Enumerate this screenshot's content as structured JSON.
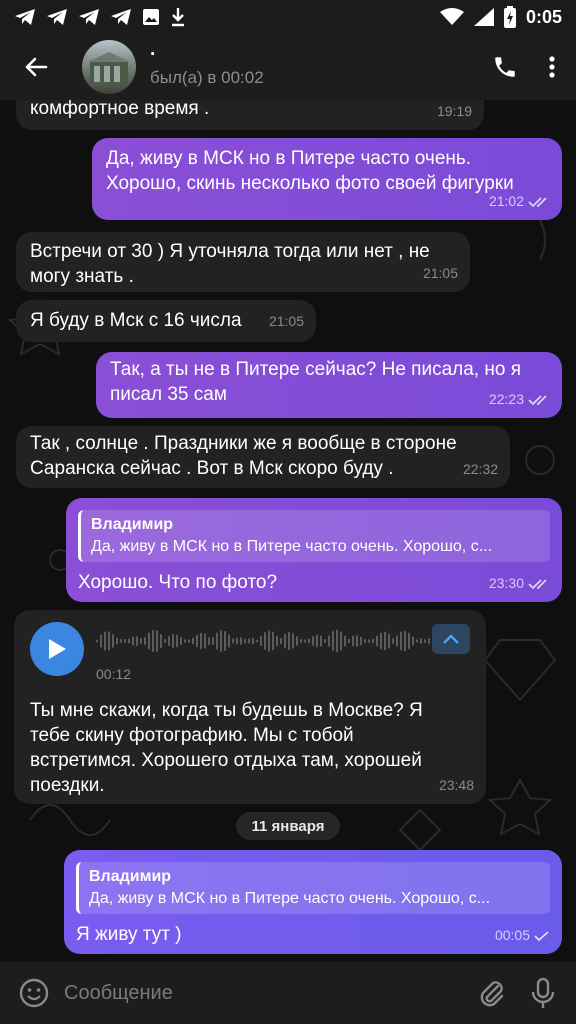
{
  "status_bar": {
    "time": "0:05"
  },
  "header": {
    "contact_name": "·",
    "last_seen": "был(а) в 00:02"
  },
  "messages": [
    {
      "id": 1,
      "direction": "in",
      "text": "комфортное время .",
      "time": "19:19"
    },
    {
      "id": 2,
      "direction": "out",
      "text": "Да, живу в МСК но в Питере часто очень. Хорошо, скинь несколько фото своей фигурки",
      "time": "21:02",
      "status": "read"
    },
    {
      "id": 3,
      "direction": "in",
      "text": "Встречи от 30 ) Я уточняла тогда или нет , не могу знать .",
      "time": "21:05"
    },
    {
      "id": 4,
      "direction": "in",
      "text": "Я буду в Мск с 16 числа",
      "time": "21:05"
    },
    {
      "id": 5,
      "direction": "out",
      "text": "Так, а ты не в Питере сейчас? Не писала, но я писал 35 сам",
      "time": "22:23",
      "status": "read"
    },
    {
      "id": 6,
      "direction": "in",
      "text": "Так , солнце . Праздники же я вообще в стороне Саранска сейчас . Вот в Мск скоро буду .",
      "time": "22:32"
    },
    {
      "id": 7,
      "direction": "out",
      "reply_to": {
        "name": "Владимир",
        "text": "Да, живу в МСК но в Питере часто очень. Хорошо, с..."
      },
      "text": "Хорошо. Что по фото?",
      "time": "23:30",
      "status": "read"
    },
    {
      "id": 8,
      "direction": "in",
      "voice": {
        "duration": "00:12"
      },
      "text": "Ты мне скажи, когда ты будешь в Москве? Я тебе скину фотографию. Мы с тобой встретимся. Хорошего отдыха там, хорошей поездки.",
      "time": "23:48"
    },
    {
      "id": 9,
      "direction": "out",
      "reply_to": {
        "name": "Владимир",
        "text": "Да, живу в МСК но в Питере часто очень. Хорошо, с..."
      },
      "text": "Я живу тут )",
      "time": "00:05",
      "status": "sent"
    }
  ],
  "date_separator": "11 января",
  "composer": {
    "placeholder": "Сообщение"
  },
  "icons": {
    "back": "arrow-left-icon",
    "call": "phone-icon",
    "menu": "more-vertical-icon",
    "emoji": "smile-icon",
    "attach": "paperclip-icon",
    "mic": "microphone-icon",
    "play": "play-icon",
    "collapse": "chevron-up-icon"
  },
  "colors": {
    "outgoing": "#8b4fd6",
    "outgoing_latest": "#6a5bea",
    "incoming": "#222222",
    "voice_play": "#3a86e0"
  }
}
